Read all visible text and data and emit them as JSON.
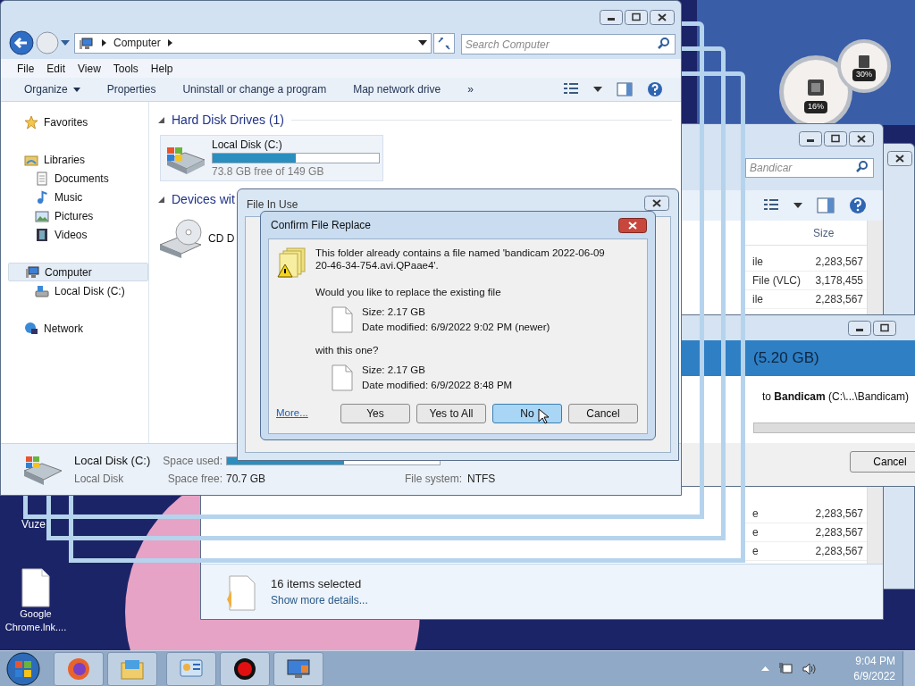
{
  "desktop_icons": [
    {
      "label": "Vuze",
      "kind": "app"
    },
    {
      "label": "Google Chrome.lnk....",
      "kind": "file"
    }
  ],
  "gadget": {
    "cpu": "16%",
    "memory": "30%"
  },
  "back_window": {
    "search_placeholder": "Bandicar",
    "size_header": "Size",
    "rows": [
      {
        "type": "ile",
        "size": "2,283,567"
      },
      {
        "type": "File (VLC)",
        "size": "3,178,455"
      },
      {
        "type": "ile",
        "size": "2,283,567"
      }
    ],
    "rows_lower": [
      {
        "type": "e",
        "size": "2,283,567"
      },
      {
        "type": "e",
        "size": "2,283,567"
      },
      {
        "type": "e",
        "size": "2,283,567"
      }
    ],
    "selection_count": "16 items selected",
    "details_link": "Show more details..."
  },
  "copy_window": {
    "total": "(5.20 GB)",
    "destination": "to **Bandicam** (C:\\...\\Bandicam)",
    "cancel": "Cancel"
  },
  "explorer": {
    "address": "Computer",
    "search_placeholder": "Search Computer",
    "menu": [
      "File",
      "Edit",
      "View",
      "Tools",
      "Help"
    ],
    "toolbar": [
      {
        "label": "Organize",
        "dropdown": true
      },
      {
        "label": "Properties",
        "dropdown": false
      },
      {
        "label": "Uninstall or change a program",
        "dropdown": false
      },
      {
        "label": "Map network drive",
        "dropdown": false
      },
      {
        "label": "»",
        "dropdown": false
      }
    ],
    "sidebar": [
      {
        "label": "Favorites",
        "selected": false
      },
      {
        "label": "Libraries",
        "selected": false,
        "children": [
          {
            "label": "Documents",
            "selected": false
          },
          {
            "label": "Music",
            "selected": false
          },
          {
            "label": "Pictures",
            "selected": false
          },
          {
            "label": "Videos",
            "selected": false
          }
        ]
      },
      {
        "label": "Computer",
        "selected": true,
        "children": [
          {
            "label": "Local Disk (C:)",
            "selected": false
          }
        ]
      },
      {
        "label": "Network",
        "selected": false
      }
    ],
    "groups": [
      {
        "header": "Hard Disk Drives (1)",
        "kind": "disk",
        "name": "Local Disk (C:)",
        "level": 0.5,
        "free": "73.8 GB free of 149 GB"
      },
      {
        "header": "Devices wit",
        "kind": "cd",
        "name": "CD D"
      }
    ],
    "details": {
      "name": "Local Disk (C:)",
      "type": "Local Disk",
      "used_label": "Space used:",
      "space_used": {
        "level": 0.55
      },
      "free_label": "Space free:",
      "free": "70.7 GB",
      "fs_label": "File system:",
      "fs": "NTFS"
    }
  },
  "file_in_use": {
    "title": "File In Use"
  },
  "confirm": {
    "title": "Confirm File Replace",
    "message": "This folder already contains a file named 'bandicam 2022-06-09 20-46-34-754.avi.QPaae4'.",
    "question": "Would you like to replace the existing file",
    "existing": {
      "size": "Size: 2.17 GB",
      "modified": "Date modified: 6/9/2022 9:02 PM (newer)"
    },
    "with": "with this one?",
    "replacement": {
      "size": "Size: 2.17 GB",
      "modified": "Date modified: 6/9/2022 8:48 PM"
    },
    "more": "More...",
    "buttons": [
      {
        "label": "Yes",
        "selected": false
      },
      {
        "label": "Yes to All",
        "selected": false
      },
      {
        "label": "No",
        "selected": true
      },
      {
        "label": "Cancel",
        "selected": false
      }
    ]
  },
  "taskbar": {
    "apps": [
      {
        "kind": "firefox"
      },
      {
        "kind": "explorer"
      },
      {
        "kind": "panel"
      },
      {
        "kind": "record"
      },
      {
        "kind": "monitor"
      }
    ],
    "time": "9:04 PM",
    "date": "6/9/2022"
  }
}
